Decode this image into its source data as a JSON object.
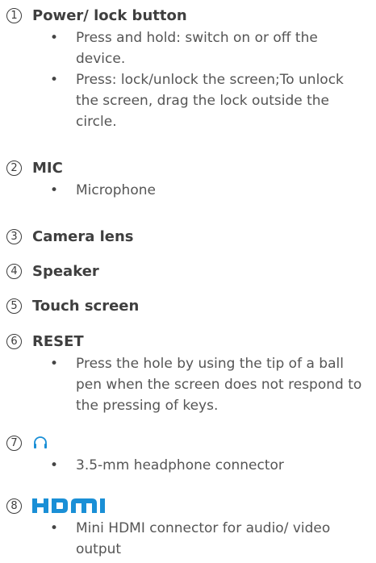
{
  "items": [
    {
      "number": "1",
      "title": "Power/ lock button",
      "bullets": [
        "Press and hold: switch on or off the device.",
        "Press: lock/unlock the screen;To unlock the screen, drag the lock outside the circle."
      ]
    },
    {
      "number": "2",
      "title": "MIC",
      "bullets": [
        "Microphone"
      ]
    },
    {
      "number": "3",
      "title": "Camera lens",
      "bullets": []
    },
    {
      "number": "4",
      "title": "Speaker",
      "bullets": []
    },
    {
      "number": "5",
      "title": "Touch screen",
      "bullets": []
    },
    {
      "number": "6",
      "title": "RESET",
      "bullets": [
        "Press the hole by using the tip of a ball pen when the screen does not respond to the pressing of keys."
      ]
    },
    {
      "number": "7",
      "icon": "headphone-icon",
      "bullets": [
        "3.5-mm headphone connector"
      ]
    },
    {
      "number": "8",
      "icon": "hdmi-logo",
      "logo_text": "HDMI",
      "bullets": [
        "Mini HDMI connector for audio/ video output"
      ]
    }
  ],
  "colors": {
    "text": "#3c3c3c",
    "bullet_text": "#555555",
    "icon_blue": "#1a8fd6"
  }
}
